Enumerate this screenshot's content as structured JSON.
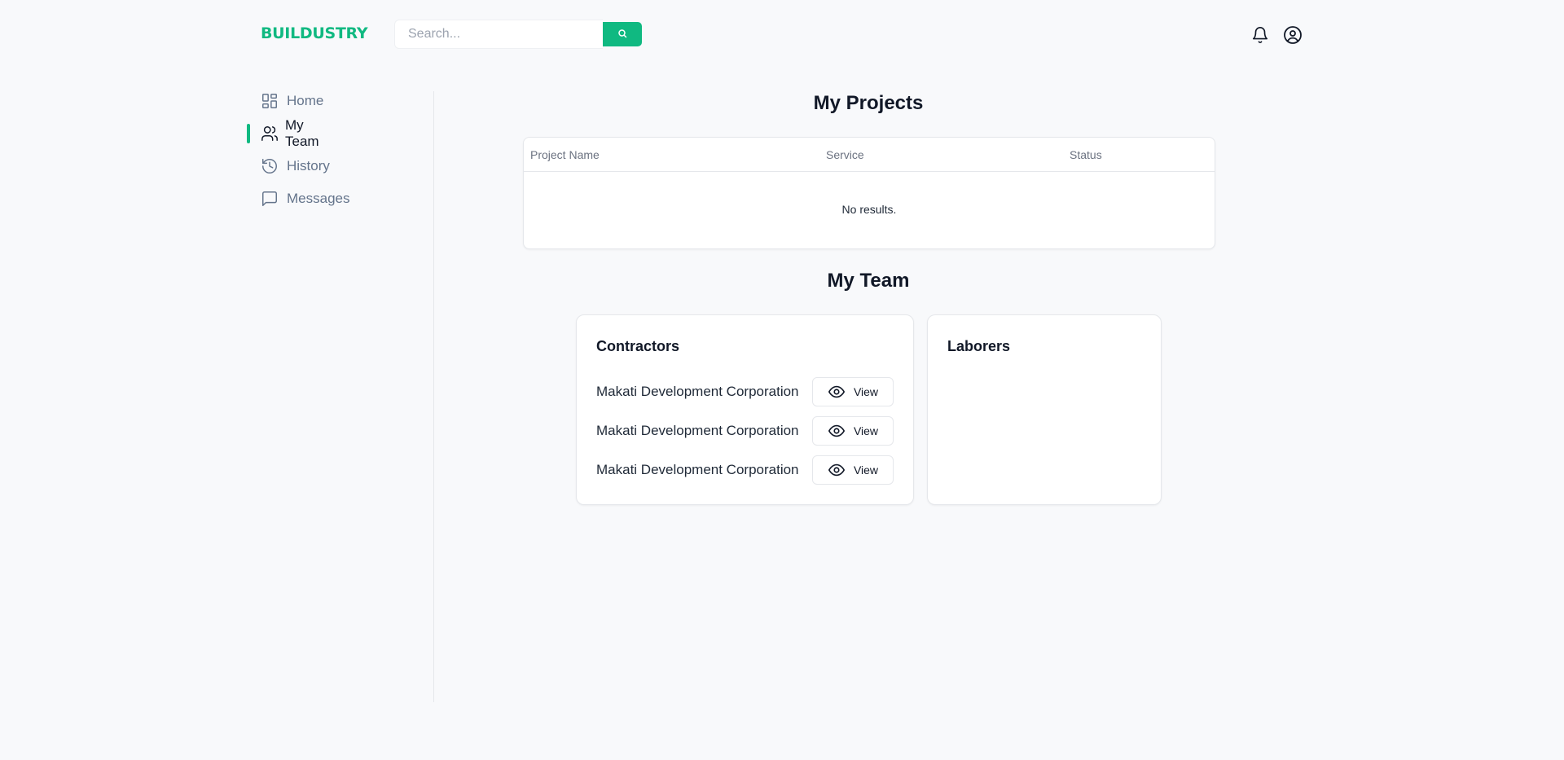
{
  "header": {
    "logo": "BUILDUSTRY",
    "search_placeholder": "Search...",
    "brand_color": "#10b981",
    "icons": [
      "search-icon",
      "bell-icon",
      "user-circle-icon"
    ]
  },
  "sidebar": {
    "items": [
      {
        "label": "Home",
        "icon": "dashboard-grid-icon",
        "active": false
      },
      {
        "label": "My Team",
        "icon": "users-icon",
        "active": true
      },
      {
        "label": "History",
        "icon": "history-icon",
        "active": false
      },
      {
        "label": "Messages",
        "icon": "message-square-icon",
        "active": false
      }
    ]
  },
  "projects": {
    "title": "My Projects",
    "columns": [
      "Project Name",
      "Service",
      "Status"
    ],
    "empty_text": "No results."
  },
  "team": {
    "title": "My Team",
    "contractors": {
      "title": "Contractors",
      "items": [
        {
          "name": "Makati Development Corporation",
          "action": "View"
        },
        {
          "name": "Makati Development Corporation",
          "action": "View"
        },
        {
          "name": "Makati Development Corporation",
          "action": "View"
        }
      ]
    },
    "laborers": {
      "title": "Laborers",
      "items": []
    }
  }
}
